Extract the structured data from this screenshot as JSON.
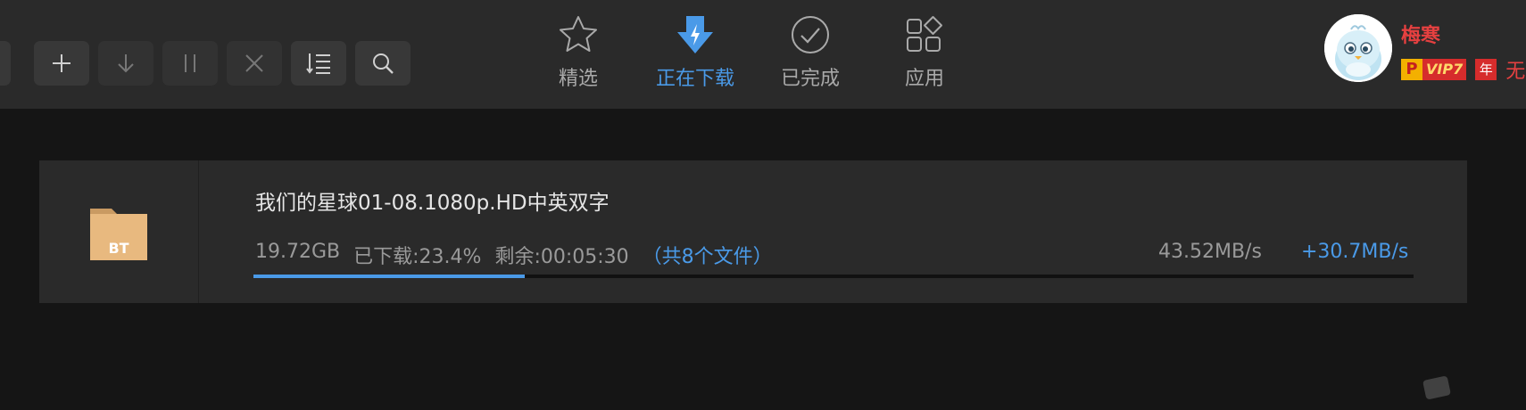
{
  "toolbar": {
    "buttons": [
      {
        "name": "add",
        "icon": "plus-icon"
      },
      {
        "name": "download",
        "icon": "arrow-down-icon"
      },
      {
        "name": "pause",
        "icon": "pause-icon"
      },
      {
        "name": "delete",
        "icon": "close-icon"
      },
      {
        "name": "sort",
        "icon": "sort-list-icon"
      },
      {
        "name": "search",
        "icon": "search-icon"
      }
    ]
  },
  "nav": {
    "tabs": [
      {
        "label": "精选",
        "icon": "star-icon",
        "active": false
      },
      {
        "label": "正在下载",
        "icon": "download-lightning-icon",
        "active": true
      },
      {
        "label": "已完成",
        "icon": "check-circle-icon",
        "active": false
      },
      {
        "label": "应用",
        "icon": "apps-grid-icon",
        "active": false
      }
    ]
  },
  "user": {
    "name": "梅寒",
    "vip_p": "P",
    "vip_label": "VIP7",
    "year_badge": "年",
    "trailing": "无"
  },
  "task": {
    "name": "我们的星球01-08.1080p.HD中英双字",
    "type_label": "BT",
    "size": "19.72GB",
    "downloaded": "已下载:23.4%",
    "remaining": "剩余:00:05:30",
    "files": "（共8个文件）",
    "speed": "43.52MB/s",
    "accelerated_speed": "+30.7MB/s",
    "progress": 0.234
  },
  "colors": {
    "accent": "#4a9ae8",
    "toolbar_bg": "#2a2a2a",
    "page_bg": "#151515",
    "folder": "#e8b97f",
    "username": "#e64040"
  }
}
